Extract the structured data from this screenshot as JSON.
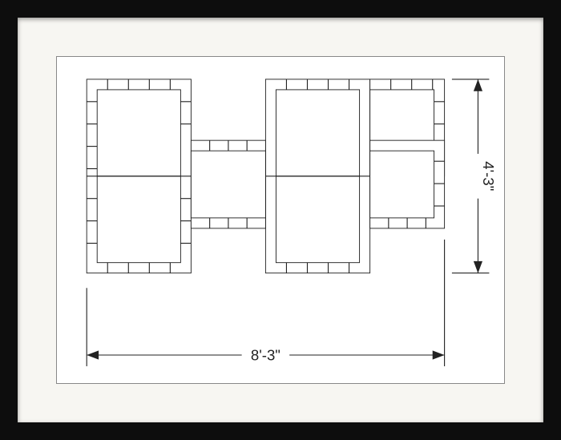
{
  "dimensions": {
    "width_label": "8'-3\"",
    "height_label": "4'-3\""
  },
  "diagram": {
    "type": "plan_view",
    "description": "Brick-bordered raised bed layout with six square cells arranged in a 2-row stepped pattern",
    "overall_width_ft_in": "8-3",
    "overall_height_ft_in": "4-3"
  }
}
